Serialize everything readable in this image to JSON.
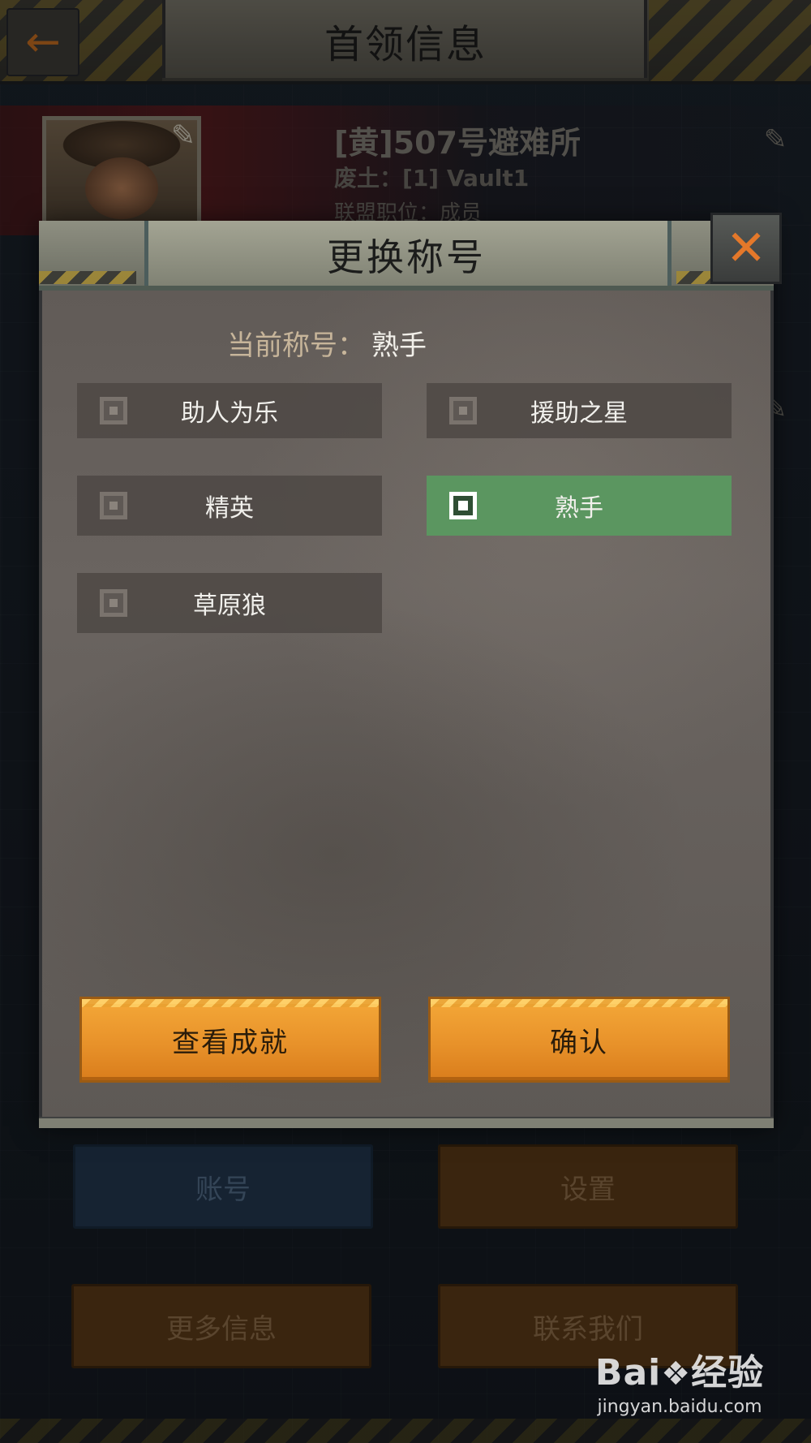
{
  "screen": {
    "title": "首领信息",
    "back_icon": "arrow-left-icon"
  },
  "profile": {
    "name": "[黄]507号避难所",
    "server_label": "废土：",
    "server_value": "[1] Vault1",
    "role_label": "联盟职位：",
    "role_value": "成员"
  },
  "background_buttons": {
    "account": "账号",
    "settings": "设置",
    "more_info": "更多信息",
    "contact_us": "联系我们"
  },
  "modal": {
    "title": "更换称号",
    "close_icon": "close-icon",
    "current_label": "当前称号：",
    "current_value": "熟手",
    "options": [
      {
        "label": "助人为乐",
        "selected": false
      },
      {
        "label": "援助之星",
        "selected": false
      },
      {
        "label": "精英",
        "selected": false
      },
      {
        "label": "熟手",
        "selected": true
      },
      {
        "label": "草原狼",
        "selected": false
      }
    ],
    "view_achievements": "查看成就",
    "confirm": "确认"
  },
  "watermark": {
    "logo_pre": "Bai",
    "logo_post": "经验",
    "url": "jingyan.baidu.com"
  },
  "colors": {
    "selected_option": "#5b9660",
    "action_button": "#e8922a",
    "close_x": "#e4782a"
  }
}
